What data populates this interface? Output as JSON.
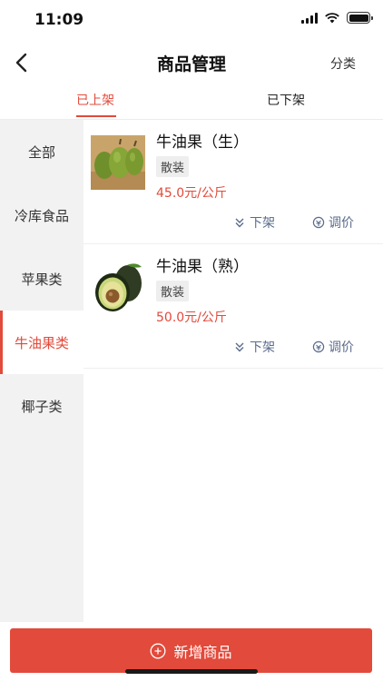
{
  "status_bar": {
    "time": "11:09"
  },
  "nav": {
    "title": "商品管理",
    "right_label": "分类"
  },
  "tabs": [
    {
      "label": "已上架",
      "active": true
    },
    {
      "label": "已下架",
      "active": false
    }
  ],
  "sidebar": {
    "items": [
      {
        "label": "全部",
        "active": false
      },
      {
        "label": "冷库食品",
        "active": false
      },
      {
        "label": "苹果类",
        "active": false
      },
      {
        "label": "牛油果类",
        "active": true
      },
      {
        "label": "椰子类",
        "active": false
      }
    ]
  },
  "products": [
    {
      "name": "牛油果（生）",
      "tag": "散装",
      "price": "45.0元/公斤",
      "action_down": "下架",
      "action_price": "调价",
      "image": "green-avocados"
    },
    {
      "name": "牛油果（熟）",
      "tag": "散装",
      "price": "50.0元/公斤",
      "action_down": "下架",
      "action_price": "调价",
      "image": "cut-avocado"
    }
  ],
  "add_button": {
    "label": "新增商品"
  },
  "colors": {
    "accent": "#e24a3b",
    "action": "#5a6b8c",
    "sidebar_bg": "#f2f2f2"
  }
}
